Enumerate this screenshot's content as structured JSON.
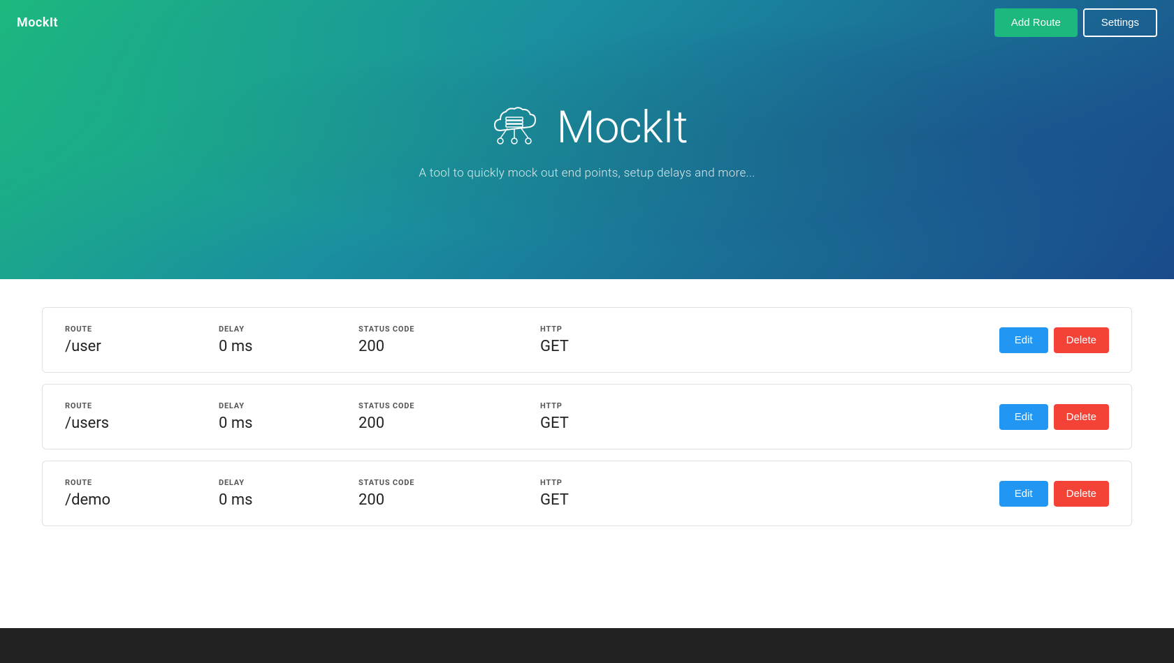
{
  "app": {
    "title": "MockIt"
  },
  "header": {
    "logo": "MockIt",
    "add_route_label": "Add Route",
    "settings_label": "Settings"
  },
  "hero": {
    "title": "MockIt",
    "subtitle": "A tool to quickly mock out end points, setup delays and more..."
  },
  "routes": [
    {
      "id": 1,
      "route_label": "ROUTE",
      "route_value": "/user",
      "delay_label": "DELAY",
      "delay_value": "0 ms",
      "status_label": "STATUS CODE",
      "status_value": "200",
      "http_label": "HTTP",
      "http_value": "GET",
      "edit_label": "Edit",
      "delete_label": "Delete"
    },
    {
      "id": 2,
      "route_label": "ROUTE",
      "route_value": "/users",
      "delay_label": "DELAY",
      "delay_value": "0 ms",
      "status_label": "STATUS CODE",
      "status_value": "200",
      "http_label": "HTTP",
      "http_value": "GET",
      "edit_label": "Edit",
      "delete_label": "Delete"
    },
    {
      "id": 3,
      "route_label": "ROUTE",
      "route_value": "/demo",
      "delay_label": "DELAY",
      "delay_value": "0 ms",
      "status_label": "STATUS CODE",
      "status_value": "200",
      "http_label": "HTTP",
      "http_value": "GET",
      "edit_label": "Edit",
      "delete_label": "Delete"
    }
  ],
  "colors": {
    "add_route_bg": "#1cb87e",
    "edit_bg": "#2196f3",
    "delete_bg": "#f44336"
  }
}
